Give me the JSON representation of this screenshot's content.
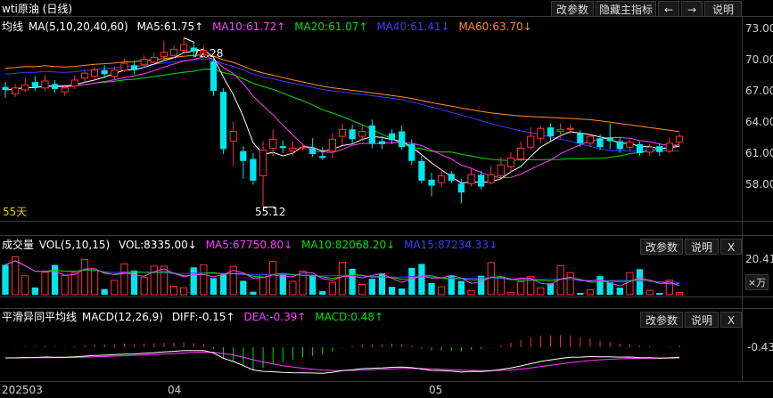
{
  "title": "wti原油 (日线)",
  "toolbar": {
    "params": "改参数",
    "hide_main": "隐藏主指标",
    "left": "←",
    "right": "→",
    "explain": "说明"
  },
  "ma": {
    "label": "均线",
    "params": "MA(5,10,20,40,60)",
    "ma5": "MA5:61.75↑",
    "ma10": "MA10:61.72↑",
    "ma20": "MA20:61.07↑",
    "ma40": "MA40:61.41↓",
    "ma60": "MA60:63.70↓",
    "colors": {
      "ma5": "#ffffff",
      "ma10": "#ff3cff",
      "ma20": "#00e000",
      "ma40": "#3c3cff",
      "ma60": "#ff8c28"
    }
  },
  "price_axis": [
    "73.00",
    "70.00",
    "67.00",
    "64.00",
    "61.00",
    "58.00"
  ],
  "annotations": {
    "high": "72.28",
    "low": "55.12",
    "days": "55天"
  },
  "volume": {
    "label": "成交量",
    "params": "VOL(5,10,15)",
    "vol": "VOL:8335.00↓",
    "ma5": "MA5:67750.80↓",
    "ma10": "MA10:82068.20↓",
    "ma15": "MA15:87234.33↓",
    "axis_top": "20.41",
    "unit": "×万",
    "buttons": {
      "params": "改参数",
      "explain": "说明",
      "close": "X"
    }
  },
  "macd": {
    "label": "平滑异同平均线",
    "params": "MACD(12,26,9)",
    "diff": "DIFF:-0.15↑",
    "dea": "DEA:-0.39↑",
    "macd": "MACD:0.48↑",
    "axis": "-0.43",
    "buttons": {
      "params": "改参数",
      "explain": "说明",
      "close": "X"
    }
  },
  "time_axis": [
    "202503",
    "04",
    "05"
  ],
  "chart_data": {
    "type": "candlestick",
    "ylim": [
      54,
      73.5
    ],
    "candles": [
      [
        67.3,
        67.0,
        67.8,
        66.2
      ],
      [
        66.6,
        67.2,
        67.6,
        66.3
      ],
      [
        67.0,
        67.5,
        68.2,
        66.8
      ],
      [
        67.8,
        67.3,
        68.4,
        66.9
      ],
      [
        67.2,
        67.9,
        68.5,
        66.9
      ],
      [
        67.6,
        67.1,
        68.0,
        66.7
      ],
      [
        66.8,
        67.2,
        67.6,
        66.4
      ],
      [
        67.4,
        68.0,
        68.5,
        67.1
      ],
      [
        68.2,
        68.7,
        69.0,
        67.8
      ],
      [
        68.4,
        69.0,
        69.3,
        68.0
      ],
      [
        69.0,
        68.6,
        69.5,
        68.2
      ],
      [
        68.4,
        69.0,
        69.4,
        68.0
      ],
      [
        69.0,
        69.7,
        70.2,
        68.8
      ],
      [
        69.5,
        69.0,
        70.0,
        68.6
      ],
      [
        69.6,
        70.1,
        70.5,
        69.2
      ],
      [
        69.8,
        70.3,
        70.8,
        69.5
      ],
      [
        70.4,
        70.8,
        72.0,
        70.1
      ],
      [
        70.5,
        71.1,
        71.5,
        70.2
      ],
      [
        71.0,
        71.6,
        72.28,
        70.8
      ],
      [
        71.3,
        70.9,
        71.8,
        70.3
      ],
      [
        70.8,
        71.0,
        71.4,
        70.3
      ],
      [
        69.9,
        66.9,
        70.2,
        66.4
      ],
      [
        66.8,
        61.0,
        67.2,
        60.5
      ],
      [
        61.8,
        62.8,
        63.8,
        59.3
      ],
      [
        60.8,
        59.8,
        61.3,
        58.0
      ],
      [
        60.0,
        57.8,
        60.6,
        57.4
      ],
      [
        58.3,
        60.9,
        61.8,
        55.12
      ],
      [
        61.1,
        62.0,
        63.0,
        60.3
      ],
      [
        61.3,
        61.1,
        61.9,
        60.6
      ],
      [
        60.8,
        61.1,
        61.8,
        60.3
      ],
      [
        61.2,
        61.2,
        61.5,
        60.9
      ],
      [
        61.1,
        60.5,
        62.1,
        60.2
      ],
      [
        60.3,
        60.1,
        61.2,
        59.9
      ],
      [
        60.8,
        62.0,
        62.6,
        60.1
      ],
      [
        62.3,
        63.0,
        63.6,
        61.4
      ],
      [
        63.0,
        62.0,
        63.5,
        61.5
      ],
      [
        62.3,
        62.8,
        63.5,
        61.8
      ],
      [
        63.4,
        61.6,
        64.0,
        61.1
      ],
      [
        61.8,
        61.5,
        62.3,
        61.0
      ],
      [
        62.6,
        61.9,
        63.0,
        61.5
      ],
      [
        62.8,
        61.2,
        63.4,
        60.9
      ],
      [
        61.5,
        59.8,
        62.0,
        59.4
      ],
      [
        59.8,
        57.8,
        60.3,
        57.5
      ],
      [
        57.9,
        57.3,
        58.6,
        56.2
      ],
      [
        57.6,
        58.3,
        59.0,
        57.2
      ],
      [
        58.5,
        57.8,
        58.8,
        57.6
      ],
      [
        57.5,
        56.6,
        58.0,
        55.5
      ],
      [
        57.5,
        58.4,
        59.0,
        57.2
      ],
      [
        58.4,
        57.2,
        58.8,
        56.9
      ],
      [
        57.6,
        58.4,
        59.3,
        57.4
      ],
      [
        58.3,
        59.4,
        60.2,
        58.1
      ],
      [
        59.2,
        60.1,
        60.7,
        58.7
      ],
      [
        60.0,
        61.1,
        61.8,
        59.8
      ],
      [
        61.2,
        62.3,
        63.2,
        61.0
      ],
      [
        62.1,
        63.1,
        63.3,
        61.6
      ],
      [
        63.2,
        62.3,
        63.6,
        61.8
      ],
      [
        62.8,
        63.0,
        63.6,
        62.1
      ],
      [
        63.0,
        63.1,
        63.5,
        62.6
      ],
      [
        62.6,
        61.6,
        62.9,
        61.2
      ],
      [
        61.6,
        62.3,
        62.6,
        61.2
      ],
      [
        62.1,
        61.2,
        62.5,
        60.9
      ],
      [
        62.2,
        61.8,
        63.6,
        61.0
      ],
      [
        61.8,
        61.0,
        62.2,
        60.6
      ],
      [
        61.2,
        61.7,
        61.9,
        60.8
      ],
      [
        61.5,
        60.6,
        61.8,
        60.3
      ],
      [
        60.7,
        61.2,
        61.5,
        60.3
      ],
      [
        61.3,
        60.7,
        61.6,
        60.3
      ],
      [
        60.8,
        61.6,
        62.2,
        60.6
      ],
      [
        61.7,
        62.3,
        62.6,
        61.2
      ]
    ]
  }
}
